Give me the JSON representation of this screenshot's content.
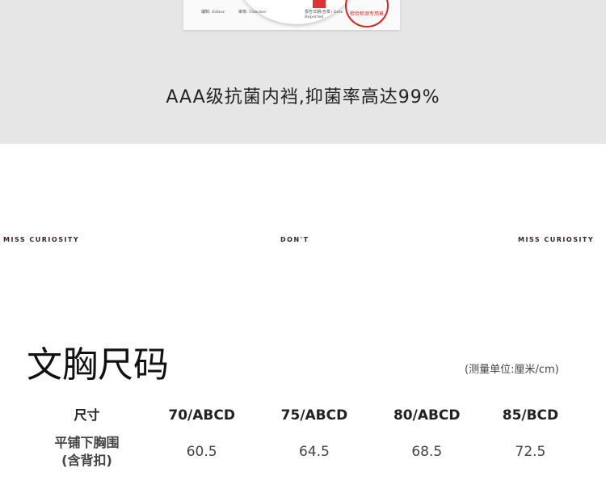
{
  "report": {
    "editor_label": "编制: Editor",
    "checker_label": "审核: Checker",
    "date_label": "报告日期(含章) Date Reported",
    "stamp_text": "检验检测专用章"
  },
  "headline": "AAA级抗菌内裆,抑菌率高达99%",
  "brands": [
    "MISS CURIOSITY",
    "DON'T",
    "MISS CURIOSITY"
  ],
  "title": "文胸尺码",
  "unit": "(测量单位:厘米/cm)",
  "table": {
    "header": [
      "尺寸",
      "70/ABCD",
      "75/ABCD",
      "80/ABCD",
      "85/BCD"
    ],
    "row": {
      "label_line1": "平铺下胸围",
      "label_line2": "(含背扣)",
      "values": [
        "60.5",
        "64.5",
        "68.5",
        "72.5"
      ]
    }
  }
}
